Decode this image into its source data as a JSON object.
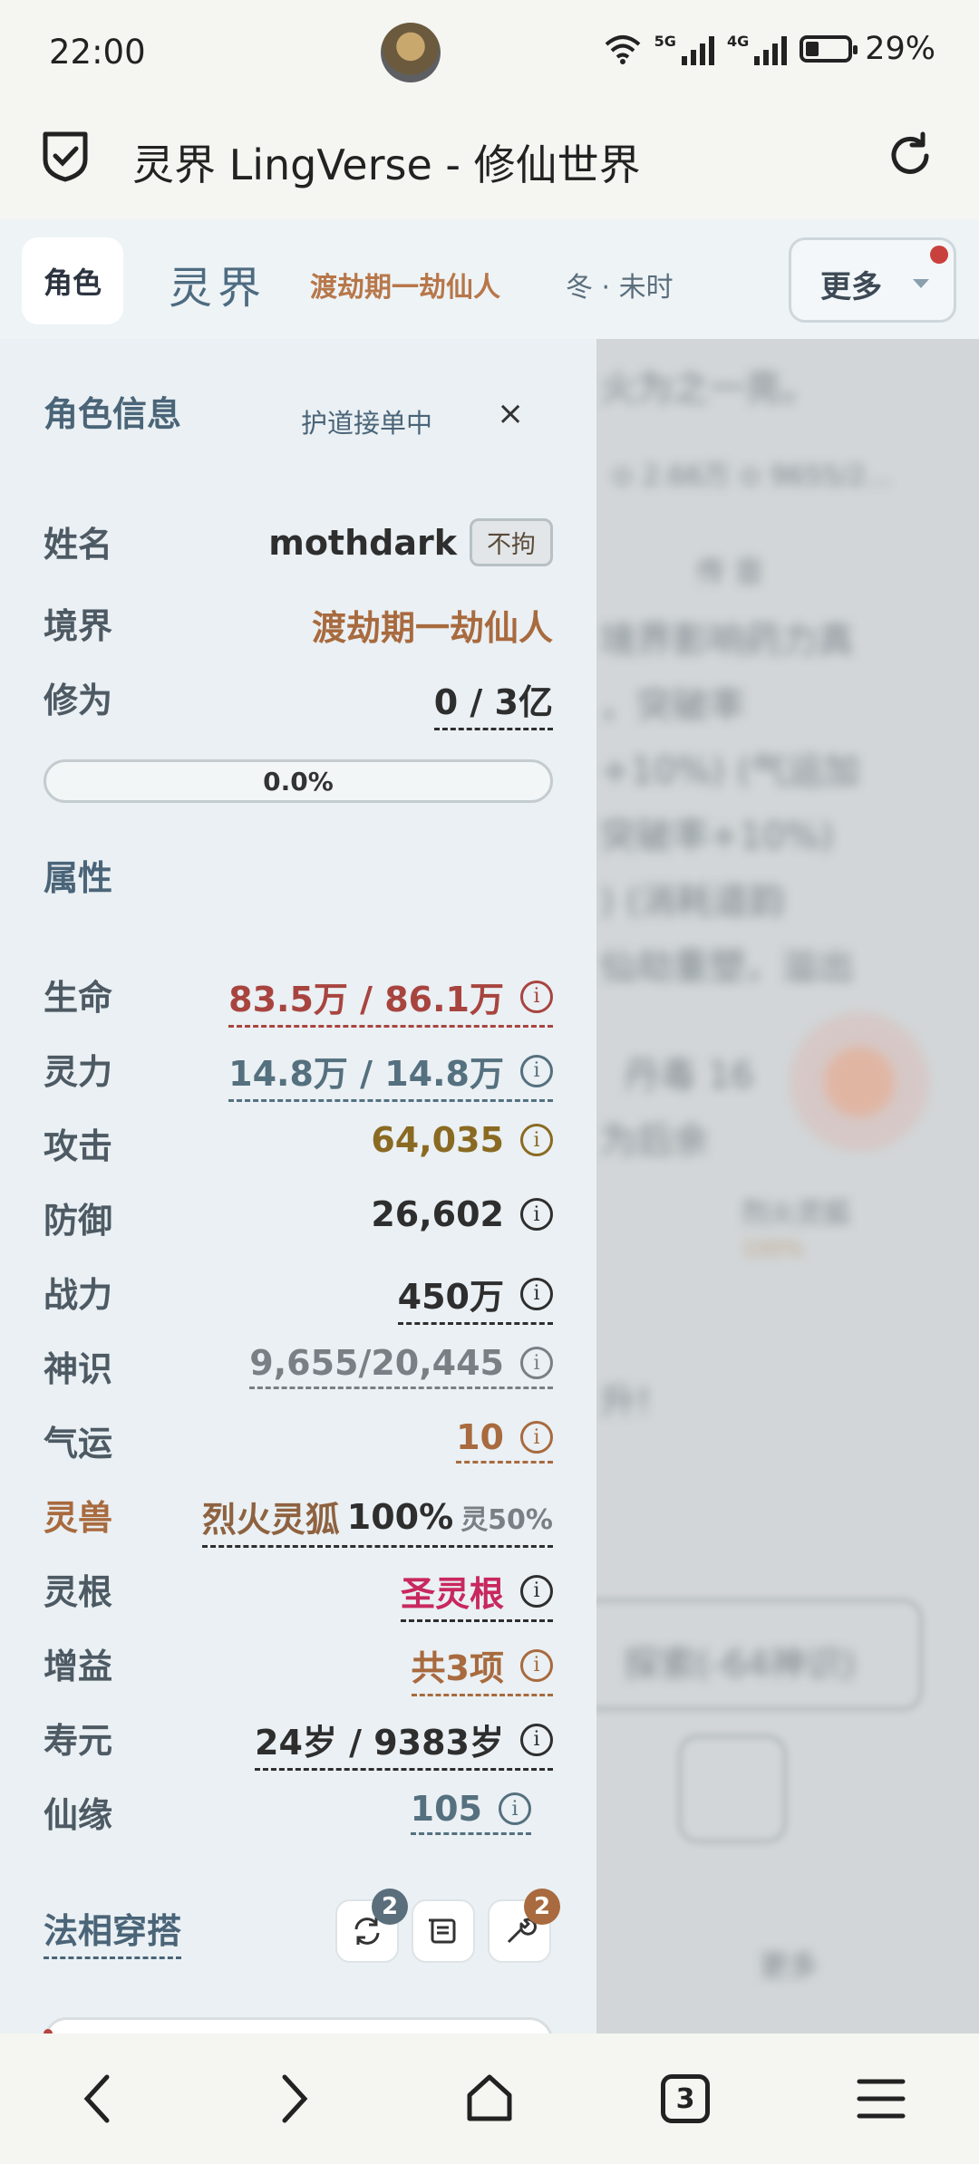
{
  "status_bar": {
    "time": "22:00",
    "signal1": "5G",
    "signal2": "4G",
    "battery": "29%"
  },
  "browser": {
    "title": "灵界 LingVerse - 修仙世界",
    "tab_count": "3"
  },
  "nav": {
    "tab_role": "角色",
    "world": "灵界",
    "realm": "渡劫期一劫仙人",
    "season": "冬 · 未时",
    "more": "更多"
  },
  "panel": {
    "title": "角色信息",
    "hudao": "护道接单中",
    "close": "×",
    "name_label": "姓名",
    "name_value": "mothdark",
    "name_badge": "不拘",
    "realm_label": "境界",
    "realm_value": "渡劫期一劫仙人",
    "cultivation_label": "修为",
    "cultivation_value": "0 / 3亿",
    "progress_text": "0.0%",
    "progress_fraction": 0.0,
    "attr_title": "属性",
    "attrs": {
      "hp": {
        "label": "生命",
        "value": "83.5万 / 86.1万"
      },
      "mp": {
        "label": "灵力",
        "value": "14.8万 / 14.8万"
      },
      "atk": {
        "label": "攻击",
        "value": "64,035"
      },
      "def": {
        "label": "防御",
        "value": "26,602"
      },
      "power": {
        "label": "战力",
        "value": "450万"
      },
      "sense": {
        "label": "神识",
        "value": "9,655/20,445"
      },
      "luck": {
        "label": "气运",
        "value": "10"
      },
      "pet": {
        "label": "灵兽",
        "name": "烈火灵狐",
        "pct": "100%",
        "extra": "灵50%"
      },
      "root": {
        "label": "灵根",
        "value": "圣灵根"
      },
      "buff": {
        "label": "增益",
        "value": "共3项"
      },
      "life": {
        "label": "寿元",
        "value": "24岁 / 9383岁"
      },
      "fate": {
        "label": "仙缘",
        "value": "105"
      }
    },
    "faxiang_title": "法相穿搭",
    "faxiang_badge1": "2",
    "faxiang_badge3": "2"
  },
  "background": {
    "line1": "火为之一亮。",
    "line2": "⊙ 2.66万   ⊙ 9655/2...",
    "line3": "传 音",
    "line4": "境界影响药力真",
    "line5": "，突破率",
    "line6": "+10%) (气运加",
    "line7": "突破率+10%)",
    "line8": ") (消耗道韵",
    "line9": "仙劫重塑，溢出",
    "line10": "丹毒 16",
    "line11": "为后余",
    "line12": "烈火灵狐",
    "line13": "100%",
    "line14": "升!",
    "line15": "探索(-64神识)",
    "line16": "更多"
  },
  "colors": {
    "hp": "#a8443f",
    "mp": "#55707f",
    "atk": "#8a6a22",
    "def": "#2e2e2e",
    "power": "#2e2e2e",
    "sense": "#7a7f86",
    "luck": "#a86a3e",
    "pet": "#8e6240",
    "root": "#c8285e",
    "buff": "#a86a3e",
    "life": "#2e2e2e",
    "fate": "#55707f",
    "realm": "#a86a3e",
    "label": "#4d5a64"
  }
}
